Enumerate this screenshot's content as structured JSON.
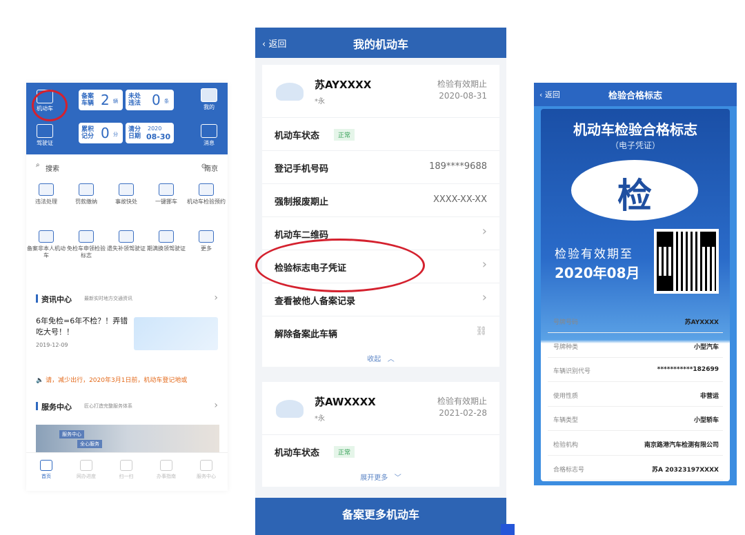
{
  "left": {
    "header": {
      "vehicle_tile": "机动车",
      "license_tile": "驾驶证",
      "mine_tile": "我的",
      "message_tile": "消息",
      "stat1": {
        "label": "备案\n车辆",
        "value": "2",
        "unit": "辆"
      },
      "stat2": {
        "label": "未处\n违法",
        "value": "0",
        "unit": "条"
      },
      "stat3": {
        "label": "累积\n记分",
        "value": "0",
        "unit": "分"
      },
      "stat4": {
        "label": "清分\n日期",
        "year": "2020",
        "date": "08-30"
      }
    },
    "search": {
      "label": "搜索",
      "city": "南京"
    },
    "grid": [
      "违法处理",
      "罚款缴纳",
      "事故快处",
      "一键挪车",
      "机动车检验预约",
      "备案非本人机动车",
      "免检车申领检验标志",
      "遗失补领驾驶证",
      "期满换领驾驶证",
      "更多"
    ],
    "news": {
      "title": "资讯中心",
      "subtitle": "最新实时地方交通资讯",
      "headline": "6年免检=6年不检？！弄错吃大号！！",
      "date": "2019-12-09"
    },
    "notice": "请，减少出行，2020年3月1日前，机动车登记地或",
    "service": {
      "title": "服务中心",
      "subtitle": "匠心打造完整服务体系",
      "tag1": "服务中心",
      "tag2": "全心服务"
    },
    "tabs": [
      "首页",
      "网办进度",
      "扫一扫",
      "办事指南",
      "服务中心"
    ]
  },
  "middle": {
    "back": "返回",
    "title": "我的机动车",
    "car1": {
      "plate": "苏AYXXXX",
      "sub": "*永",
      "valid_label": "检验有效期止",
      "valid_date": "2020-08-31",
      "rows": {
        "status": "机动车状态",
        "status_badge": "正常",
        "phone_label": "登记手机号码",
        "phone_value": "189****9688",
        "scrap_label": "强制报废期止",
        "scrap_value": "XXXX-XX-XX",
        "qr_label": "机动车二维码",
        "cert_label": "检验标志电子凭证",
        "record_label": "查看被他人备案记录",
        "remove_label": "解除备案此车辆"
      },
      "fold": "收起"
    },
    "car2": {
      "plate": "苏AWXXXX",
      "sub": "*永",
      "valid_label": "检验有效期止",
      "valid_date": "2021-02-28",
      "status": "机动车状态",
      "status_badge": "正常",
      "expand": "展开更多"
    },
    "bottom_button": "备案更多机动车"
  },
  "right": {
    "back": "返回",
    "title": "检验合格标志",
    "cert_title": "机动车检验合格标志",
    "cert_sub": "（电子凭证）",
    "cert_char": "检",
    "valid_label": "检验有效期至",
    "valid_date": "2020年08月",
    "info": [
      {
        "label": "号牌号码",
        "value": "苏AYXXXX"
      },
      {
        "label": "号牌种类",
        "value": "小型汽车"
      },
      {
        "label": "车辆识别代号",
        "value": "***********182699"
      },
      {
        "label": "使用性质",
        "value": "非营运"
      },
      {
        "label": "车辆类型",
        "value": "小型轿车"
      },
      {
        "label": "检验机构",
        "value": "南京路港汽车检测有限公司"
      },
      {
        "label": "合格标志号",
        "value": "苏A 20323197XXXX"
      }
    ]
  },
  "colors": {
    "primary": "#2f69c0",
    "highlight": "#d4212e",
    "ok": "#3aa35a"
  }
}
